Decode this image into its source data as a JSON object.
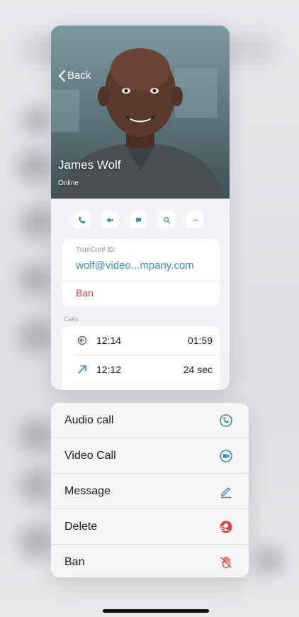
{
  "contact": {
    "back_label": "Back",
    "name": "James Wolf",
    "status": "Online"
  },
  "quick_actions": [
    "audio-call",
    "video-call",
    "message",
    "search",
    "more"
  ],
  "info": {
    "id_label": "TrueConf ID:",
    "id_value": "wolf@video...mpany.com",
    "ban_label": "Ban"
  },
  "calls": {
    "label": "Calls:",
    "items": [
      {
        "type": "missed",
        "time": "12:14",
        "duration": "01:59"
      },
      {
        "type": "outgoing",
        "time": "12:12",
        "duration": "24 sec"
      }
    ]
  },
  "menu": {
    "items": [
      {
        "label": "Audio call",
        "icon": "phone-icon"
      },
      {
        "label": "Video Call",
        "icon": "video-camera-icon"
      },
      {
        "label": "Message",
        "icon": "pencil-icon"
      },
      {
        "label": "Delete",
        "icon": "remove-user-icon"
      },
      {
        "label": "Ban",
        "icon": "block-hand-icon"
      }
    ]
  },
  "colors": {
    "accent": "#3a8ea5",
    "danger": "#d9413a"
  }
}
